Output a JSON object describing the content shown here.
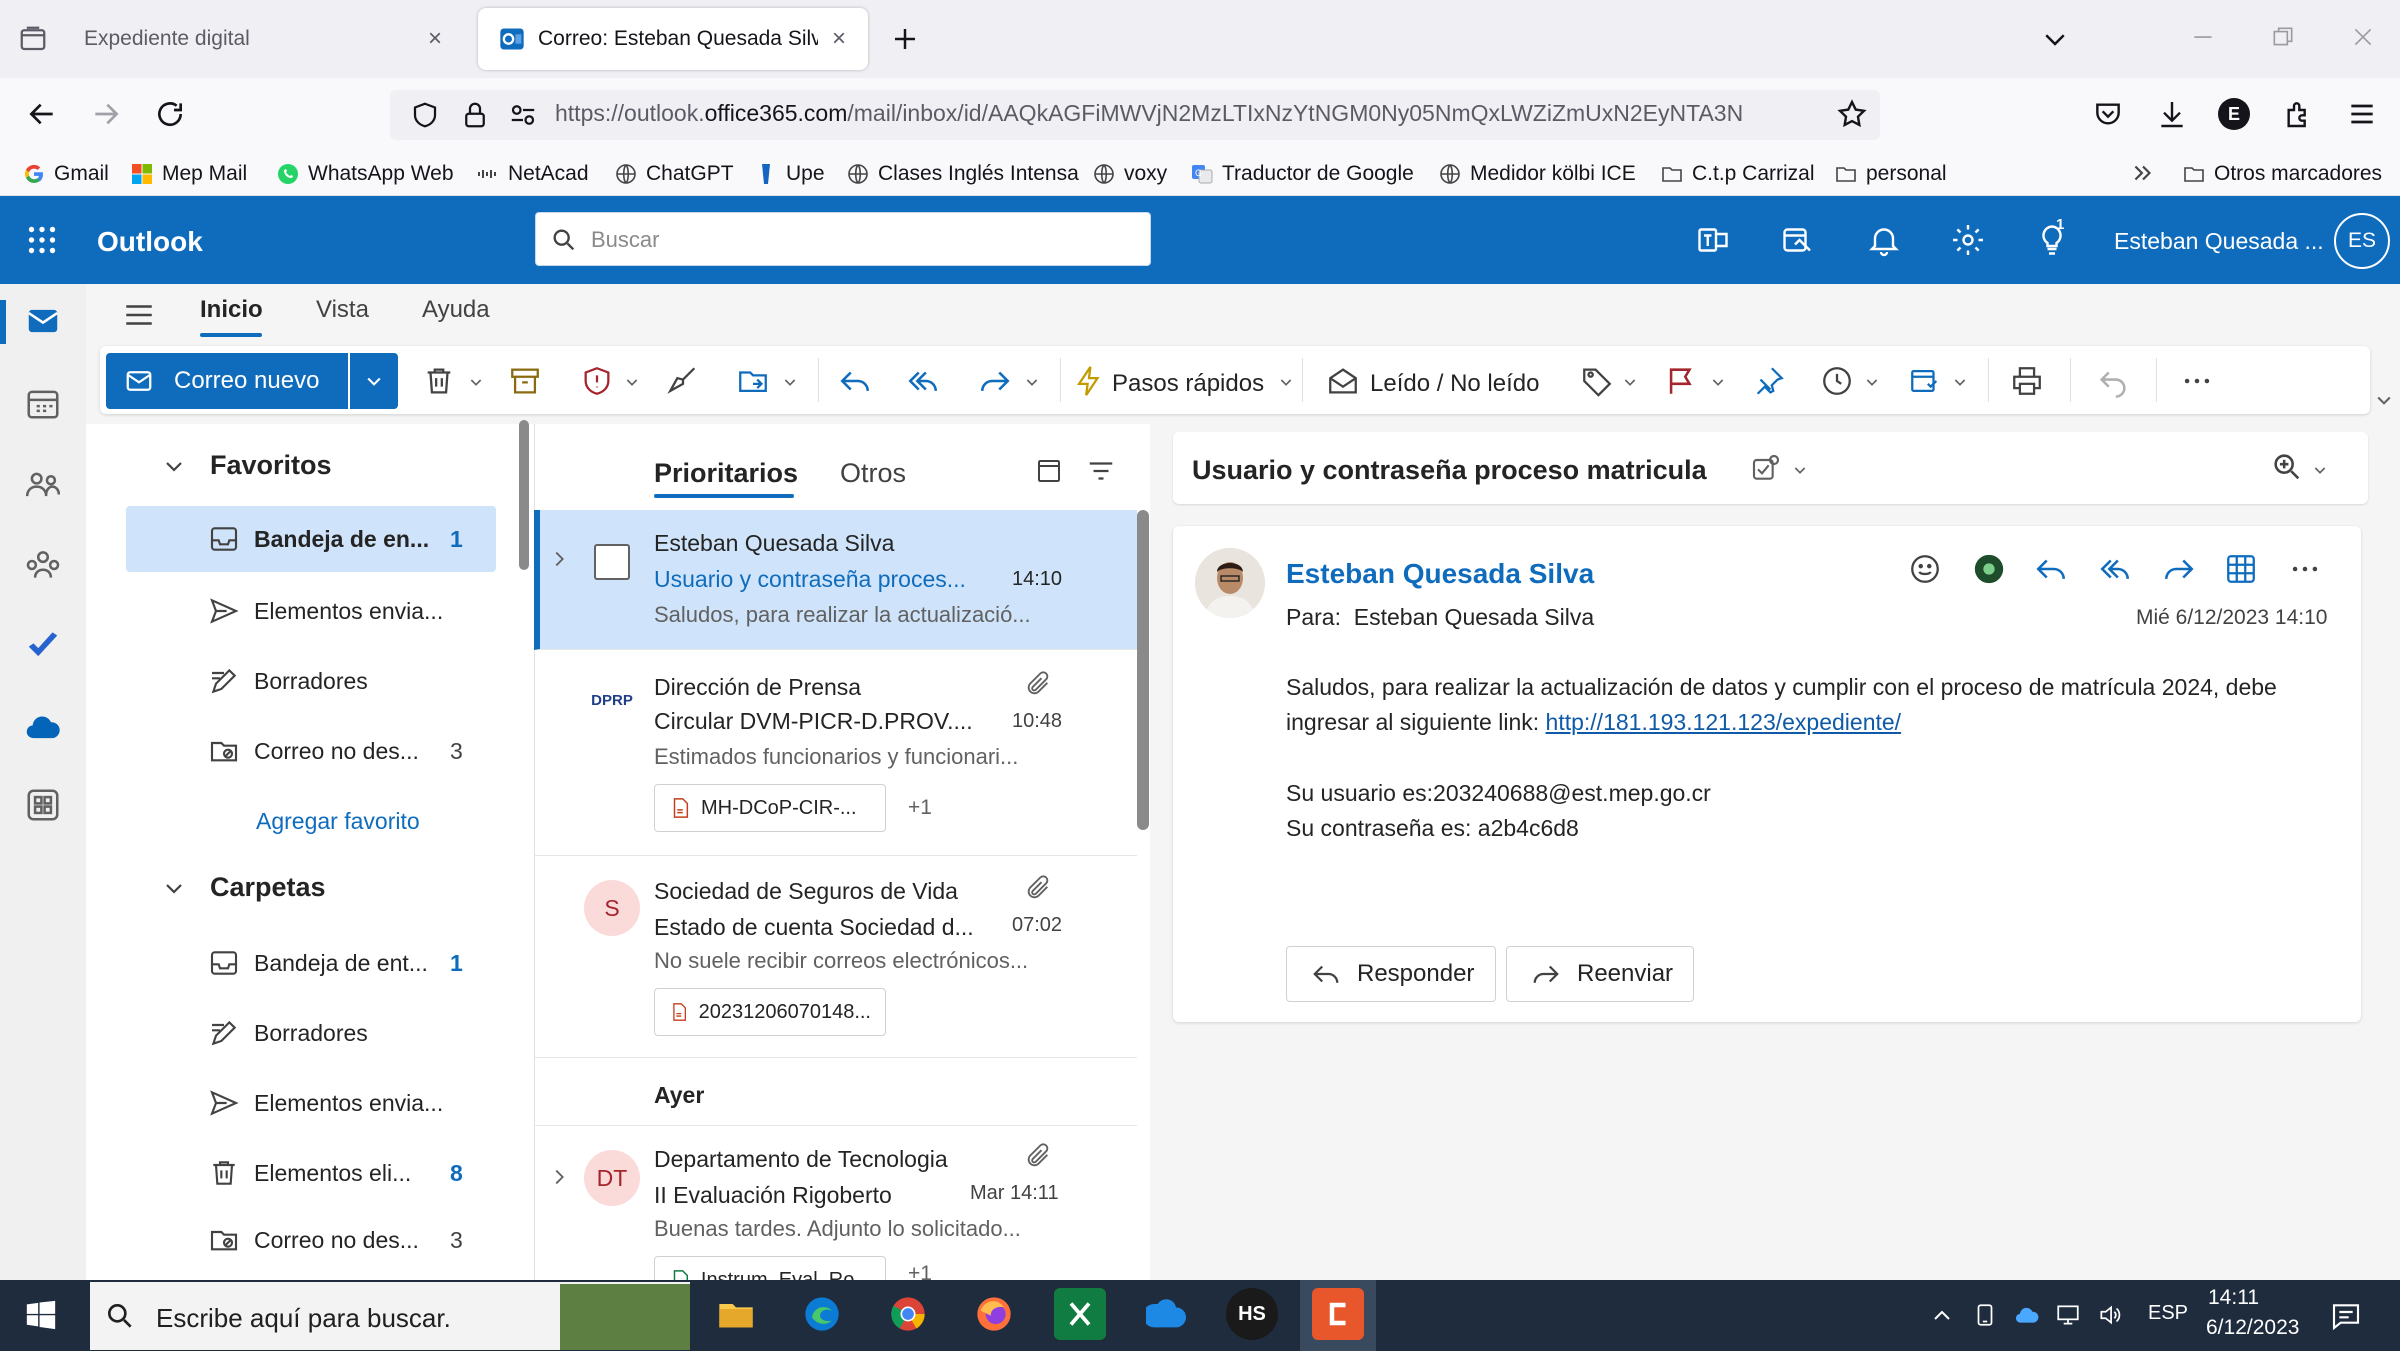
{
  "browser": {
    "tabs": [
      {
        "title": "Expediente digital"
      },
      {
        "title": "Correo: Esteban Quesada Silva -"
      }
    ],
    "url_prefix": "https://outlook.",
    "url_domain": "office365.com",
    "url_rest": "/mail/inbox/id/AAQkAGFiMWVjN2MzLTIxNzYtNGM0Ny05NmQxLWZiZmUxN2EyNTA3N",
    "bookmarks": [
      "Gmail",
      "Mep Mail",
      "WhatsApp Web",
      "NetAcad",
      "ChatGPT",
      "Upe",
      "Clases Inglés Intensa",
      "voxy",
      "Traductor de Google",
      "Medidor kölbi ICE",
      "C.t.p Carrizal",
      "personal"
    ],
    "other_bookmarks": "Otros marcadores",
    "profile_letter": "E"
  },
  "outlook": {
    "app_name": "Outlook",
    "search_placeholder": "Buscar",
    "tips_badge": "1",
    "user_name": "Esteban Quesada ...",
    "user_initials": "ES",
    "accent": "#0f6cbd"
  },
  "ribbon": {
    "tabs": [
      "Inicio",
      "Vista",
      "Ayuda"
    ],
    "new_mail": "Correo nuevo",
    "quick_steps": "Pasos rápidos",
    "read_unread": "Leído / No leído"
  },
  "folders": {
    "favorites_title": "Favoritos",
    "favorites": [
      {
        "label": "Bandeja de en...",
        "count": "1"
      },
      {
        "label": "Elementos envia...",
        "count": ""
      },
      {
        "label": "Borradores",
        "count": ""
      },
      {
        "label": "Correo no des...",
        "count": "3"
      }
    ],
    "add_favorite": "Agregar favorito",
    "folders_title": "Carpetas",
    "folders": [
      {
        "label": "Bandeja de ent...",
        "count": "1"
      },
      {
        "label": "Borradores",
        "count": ""
      },
      {
        "label": "Elementos envia...",
        "count": ""
      },
      {
        "label": "Elementos eli...",
        "count": "8"
      },
      {
        "label": "Correo no des...",
        "count": "3"
      }
    ]
  },
  "mail_list": {
    "tabs": [
      "Prioritarios",
      "Otros"
    ],
    "group_yesterday": "Ayer",
    "items": [
      {
        "sender": "Esteban Quesada Silva",
        "subject": "Usuario y contraseña proces...",
        "time": "14:10",
        "preview": "Saludos, para realizar la actualizació..."
      },
      {
        "sender": "Dirección de Prensa",
        "subject": "Circular DVM-PICR-D.PROV....",
        "time": "10:48",
        "preview": "Estimados funcionarios y funcionari...",
        "avatar": "DPRP",
        "attachment": "MH-DCoP-CIR-...",
        "more": "+1"
      },
      {
        "sender": "Sociedad de Seguros de Vida",
        "subject": "Estado de cuenta Sociedad d...",
        "time": "07:02",
        "preview": "No suele recibir correos electrónicos...",
        "avatar": "S",
        "attachment": "20231206070148..."
      },
      {
        "sender": "Departamento de Tecnologia",
        "subject": "II Evaluación Rigoberto",
        "time": "Mar 14:11",
        "preview": "Buenas tardes. Adjunto lo solicitado...",
        "avatar": "DT",
        "attachment": "Instrum_Eval_Ro...",
        "more": "+1"
      }
    ]
  },
  "reading": {
    "subject": "Usuario y contraseña proceso matricula",
    "from": "Esteban Quesada Silva",
    "to_label": "Para:",
    "to": "Esteban Quesada Silva",
    "date": "Mié 6/12/2023 14:10",
    "body_line1": "Saludos, para realizar la actualización de datos y cumplir con el proceso de matrícula 2024, debe",
    "body_line2": "ingresar al siguiente link: ",
    "link": "http://181.193.121.123/expediente/",
    "body_user": "Su usuario es:203240688@est.mep.go.cr",
    "body_pass": "Su contraseña es: a2b4c6d8",
    "reply": "Responder",
    "forward": "Reenviar"
  },
  "taskbar": {
    "search_placeholder": "Escribe aquí para buscar.",
    "lang": "ESP",
    "time": "14:11",
    "date": "6/12/2023",
    "apps": [
      "file-explorer",
      "edge",
      "chrome",
      "firefox",
      "excel",
      "store",
      "HS",
      "canva"
    ]
  }
}
